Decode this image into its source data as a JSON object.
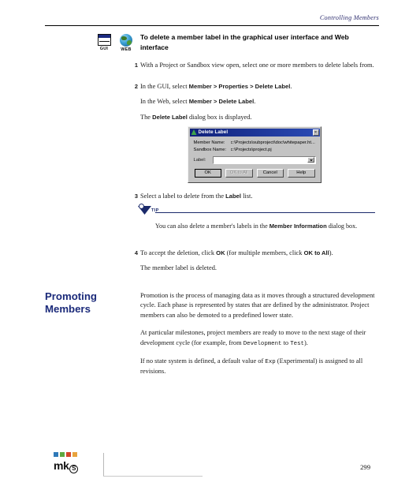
{
  "header": {
    "running_title": "Controlling Members"
  },
  "procedure": {
    "icons": [
      {
        "name": "gui-icon",
        "label": "GUI"
      },
      {
        "name": "web-icon",
        "label": "WEB"
      }
    ],
    "heading": "To delete a member label in the graphical user interface and Web interface",
    "steps": [
      {
        "number": "1",
        "paragraphs": [
          "With a Project or Sandbox view open, select one or more members to delete labels from."
        ]
      },
      {
        "number": "2",
        "paragraphs": [
          "In the GUI, select Member > Properties > Delete Label.",
          "In the Web, select Member > Delete Label.",
          "The Delete Label dialog box is displayed."
        ]
      },
      {
        "number": "3",
        "paragraphs": [
          "Select a label to delete from the Label list."
        ]
      },
      {
        "number": "4",
        "paragraphs": [
          "To accept the deletion, click OK (for multiple members, click OK to All).",
          "The member label is deleted."
        ]
      }
    ]
  },
  "dialog": {
    "title": "Delete Label",
    "close_label": "×",
    "fields": [
      {
        "label": "Member Name:",
        "value": "c:\\Projects\\subproject\\doc\\whitepaper.ht..."
      },
      {
        "label": "Sandbox Name:",
        "value": "c:\\Projects\\project.pj"
      }
    ],
    "combo": {
      "label": "Label:",
      "value": "",
      "options": []
    },
    "buttons": [
      {
        "label": "OK",
        "state": "default"
      },
      {
        "label": "OK to All",
        "state": "disabled"
      },
      {
        "label": "Cancel",
        "state": "normal"
      },
      {
        "label": "Help",
        "state": "normal"
      }
    ]
  },
  "tip": {
    "word": "TIP",
    "text": "You can also delete a member's labels in the Member Information dialog box."
  },
  "section": {
    "title": "Promoting Members",
    "paragraphs": [
      "Promotion is the process of managing data as it moves through a structured development cycle. Each phase is represented by states that are defined by the administrator. Project members can also be demoted to a predefined lower state.",
      "At particular milestones, project members are ready to move to the next stage of their development cycle (for example, from Development to Test).",
      "If no state system is defined, a default value of Exp (Experimental) is assigned to all revisions."
    ],
    "inline_code": [
      "Development",
      "Test",
      "Exp"
    ]
  },
  "footer": {
    "logo_text": "mk",
    "logo_mark": "S",
    "swatch_colors": [
      "#2f79b8",
      "#5ea83f",
      "#d4442a",
      "#e8a33d"
    ],
    "page_number": "299"
  }
}
